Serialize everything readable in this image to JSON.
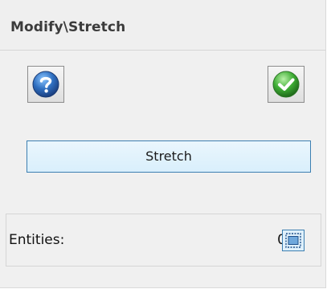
{
  "header": {
    "title": "Modify\\Stretch"
  },
  "toolbar": {
    "help_icon": "help-icon",
    "ok_icon": "checkmark-icon"
  },
  "main": {
    "stretch_label": "Stretch"
  },
  "entities": {
    "label": "Entities:",
    "count": "0",
    "select_icon": "selection-window-icon"
  },
  "colors": {
    "accent_border": "#3c7fb1",
    "help_blue": "#2f6fc0",
    "ok_green": "#3fae35",
    "panel_bg": "#f0f0f0"
  }
}
